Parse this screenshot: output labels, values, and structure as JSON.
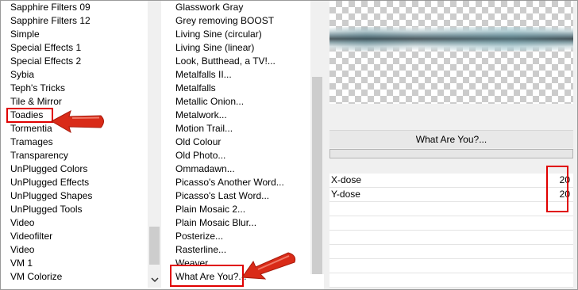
{
  "categories": {
    "items": [
      "Sapphire Filters 09",
      "Sapphire Filters 12",
      "Simple",
      "Special Effects 1",
      "Special Effects 2",
      "Sybia",
      "Teph's Tricks",
      "Tile & Mirror",
      "Toadies",
      "Tormentia",
      "Tramages",
      "Transparency",
      "UnPlugged Colors",
      "UnPlugged Effects",
      "UnPlugged Shapes",
      "UnPlugged Tools",
      "Video",
      "Videofilter",
      "Video",
      "VM 1",
      "VM Colorize"
    ],
    "selected": "Toadies"
  },
  "filters": {
    "items": [
      "Glasswork Gray",
      "Grey removing BOOST",
      "Living Sine (circular)",
      "Living Sine (linear)",
      "Look, Butthead, a TV!...",
      "Metalfalls II...",
      "Metalfalls",
      "Metallic Onion...",
      "Metalwork...",
      "Motion Trail...",
      "Old Colour",
      "Old Photo...",
      "Ommadawn...",
      "Picasso's Another Word...",
      "Picasso's Last Word...",
      "Plain Mosaic 2...",
      "Plain Mosaic Blur...",
      "Posterize...",
      "Rasterline...",
      "Weaver...",
      "What Are You?..."
    ],
    "selected": "What Are You?..."
  },
  "filter_panel": {
    "title": "What Are You?...",
    "params": [
      {
        "name": "X-dose",
        "value": "20"
      },
      {
        "name": "Y-dose",
        "value": "20"
      }
    ]
  },
  "colors": {
    "highlight": "#e00000",
    "arrow": "#d92b18"
  }
}
